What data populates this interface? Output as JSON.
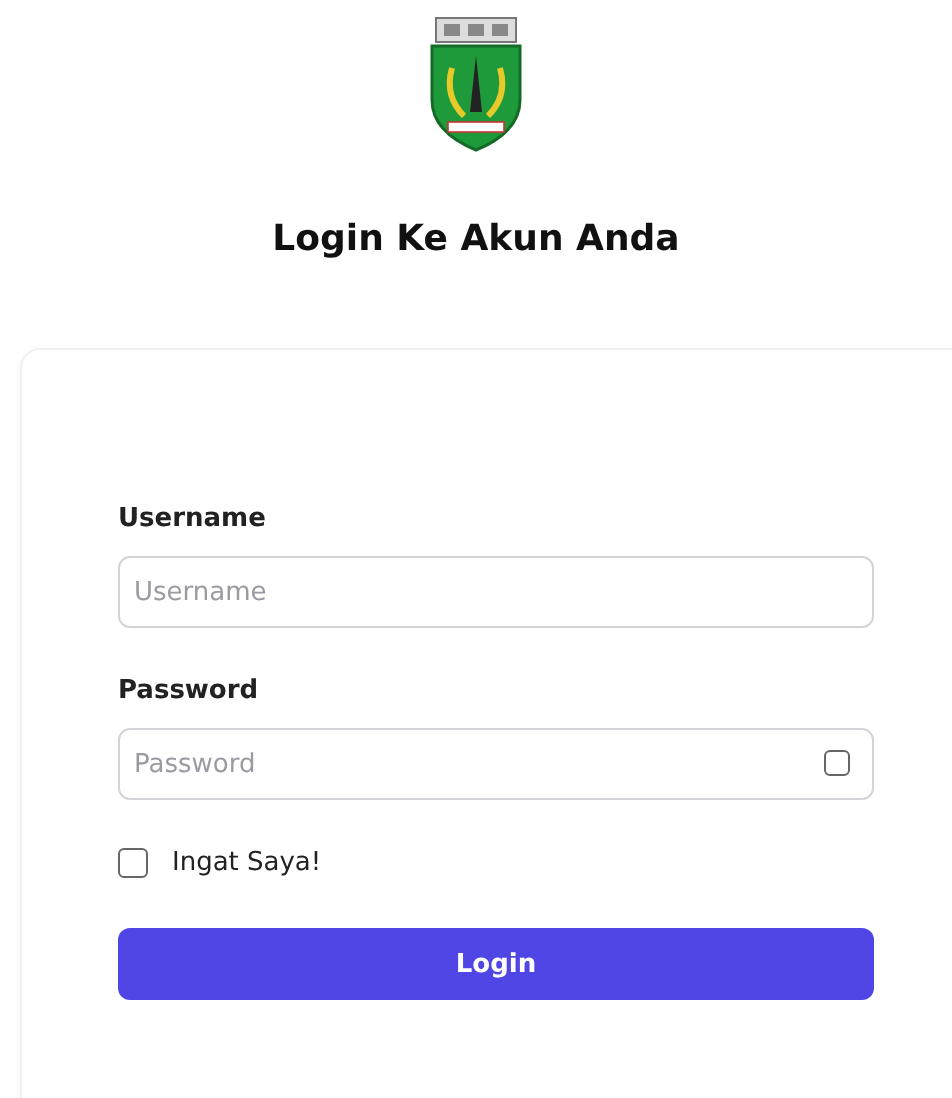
{
  "title": "Login Ke Akun Anda",
  "form": {
    "fields": [
      {
        "kind": "text",
        "label": "Username",
        "placeholder": "Username"
      },
      {
        "kind": "password",
        "label": "Password",
        "placeholder": "Password",
        "show_toggle_checked": false
      }
    ],
    "remember": {
      "label": "Ingat Saya!",
      "checked": false
    },
    "submit": "Login"
  }
}
